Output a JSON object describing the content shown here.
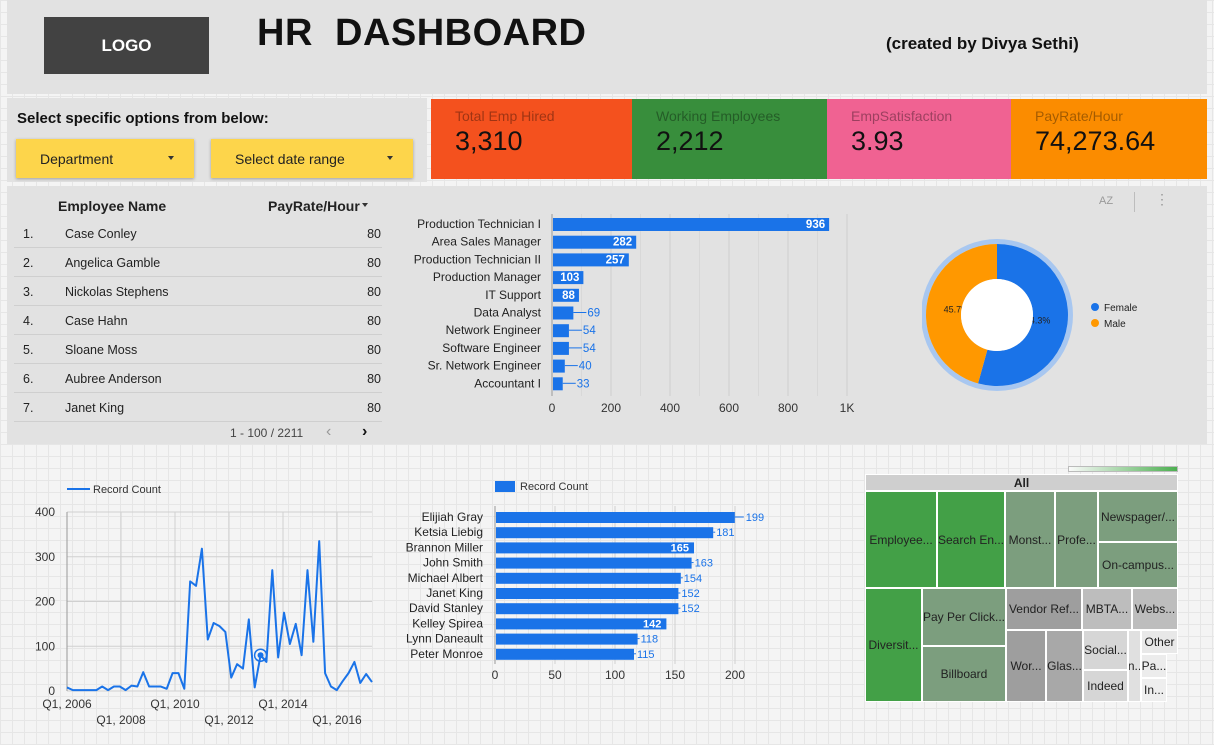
{
  "header": {
    "logo": "LOGO",
    "title": "HR  DASHBOARD",
    "credit": "(created by Divya Sethi)"
  },
  "filters": {
    "heading": "Select specific options from below:",
    "department": "Department",
    "date_range": "Select date range"
  },
  "kpis": [
    {
      "label": "Total Emp Hired",
      "value": "3,310",
      "color": "#f4511e"
    },
    {
      "label": "Working Employees",
      "value": "2,212",
      "color": "#388e3c"
    },
    {
      "label": "EmpSatisfaction",
      "value": "3.93",
      "color": "#f06292"
    },
    {
      "label": "PayRate/Hour",
      "value": "74,273.64",
      "color": "#fb8c00"
    }
  ],
  "table": {
    "columns": [
      "Employee Name",
      "PayRate/Hour"
    ],
    "rows": [
      {
        "n": "1.",
        "name": "Case Conley",
        "pay": "80"
      },
      {
        "n": "2.",
        "name": "Angelica Gamble",
        "pay": "80"
      },
      {
        "n": "3.",
        "name": "Nickolas Stephens",
        "pay": "80"
      },
      {
        "n": "4.",
        "name": "Case Hahn",
        "pay": "80"
      },
      {
        "n": "5.",
        "name": "Sloane Moss",
        "pay": "80"
      },
      {
        "n": "6.",
        "name": "Aubree Anderson",
        "pay": "80"
      },
      {
        "n": "7.",
        "name": "Janet King",
        "pay": "80"
      }
    ],
    "pager": "1 - 100 / 2211",
    "prev": "‹",
    "next": "›"
  },
  "toolbar": {
    "sort_icon": "AZ",
    "more_icon": "⋮"
  },
  "chart_data": [
    {
      "type": "bar",
      "orientation": "horizontal",
      "categories": [
        "Production Technician I",
        "Area Sales Manager",
        "Production Technician II",
        "Production Manager",
        "IT Support",
        "Data Analyst",
        "Network Engineer",
        "Software Engineer",
        "Sr. Network Engineer",
        "Accountant I"
      ],
      "values": [
        936,
        282,
        257,
        103,
        88,
        69,
        54,
        54,
        40,
        33
      ],
      "xlim": [
        0,
        1000
      ],
      "xticks": [
        "0",
        "200",
        "400",
        "600",
        "800",
        "1K"
      ],
      "grid": true,
      "color": "#1a73e8"
    },
    {
      "type": "pie",
      "donut": true,
      "labels": [
        "Female",
        "Male"
      ],
      "values": [
        54.3,
        45.7
      ],
      "value_labels": [
        "54.3%",
        "45.7%"
      ],
      "colors": [
        "#1a73e8",
        "#ff9800"
      ],
      "legend": "right"
    },
    {
      "type": "line",
      "series": [
        {
          "name": "Record Count"
        }
      ],
      "x": [
        2005,
        2005.25,
        2005.5,
        2005.75,
        2006,
        2006.25,
        2006.5,
        2006.75,
        2007,
        2007.25,
        2007.5,
        2007.75,
        2008,
        2008.25,
        2008.5,
        2008.75,
        2009,
        2009.25,
        2009.5,
        2009.75,
        2010,
        2010.25,
        2010.5,
        2010.75,
        2011,
        2011.25,
        2011.5,
        2011.75,
        2012,
        2012.25,
        2012.5,
        2012.75,
        2013,
        2013.25,
        2013.5,
        2013.75,
        2014,
        2014.25,
        2014.5,
        2014.75,
        2015,
        2015.25,
        2015.5,
        2015.75,
        2016,
        2016.25,
        2016.5,
        2016.75,
        2017
      ],
      "y": [
        8,
        2,
        2,
        2,
        2,
        2,
        10,
        2,
        10,
        10,
        2,
        12,
        10,
        42,
        10,
        10,
        10,
        5,
        40,
        40,
        5,
        245,
        235,
        318,
        115,
        152,
        145,
        132,
        30,
        60,
        50,
        160,
        8,
        80,
        65,
        270,
        75,
        175,
        105,
        150,
        80,
        270,
        110,
        335,
        40,
        10,
        2,
        22,
        40,
        65,
        18,
        38,
        20
      ],
      "ylim": [
        0,
        400
      ],
      "yticks": [
        "0",
        "100",
        "200",
        "300",
        "400"
      ],
      "xticks_row1": [
        "Q1, 2006",
        "Q1, 2010",
        "Q1, 2014"
      ],
      "xticks_row2": [
        "Q1, 2008",
        "Q1, 2012",
        "Q1, 2016"
      ],
      "legend": "top-left",
      "color": "#1a73e8"
    },
    {
      "type": "bar",
      "orientation": "horizontal",
      "series": [
        {
          "name": "Record Count"
        }
      ],
      "categories": [
        "Elijiah Gray",
        "Ketsia Liebig",
        "Brannon Miller",
        "John Smith",
        "Michael Albert",
        "Janet King",
        "David Stanley",
        "Kelley Spirea",
        "Lynn Daneault",
        "Peter Monroe"
      ],
      "values": [
        199,
        181,
        165,
        163,
        154,
        152,
        152,
        142,
        118,
        115
      ],
      "xlim": [
        0,
        200
      ],
      "xticks": [
        "0",
        "50",
        "100",
        "150",
        "200"
      ],
      "legend": "top-left",
      "color": "#1a73e8"
    },
    {
      "type": "treemap",
      "root": "All",
      "labels": [
        "Employee...",
        "Search En...",
        "Monst...",
        "Profe...",
        "Newspager/...",
        "On-campus...",
        "Diversit...",
        "Pay Per Click...",
        "Billboard",
        "Vendor Ref...",
        "MBTA...",
        "Webs...",
        "Wor...",
        "Glas...",
        "Social...",
        "Indeed",
        "In...",
        "Other",
        "Pa...",
        "In..."
      ]
    }
  ]
}
